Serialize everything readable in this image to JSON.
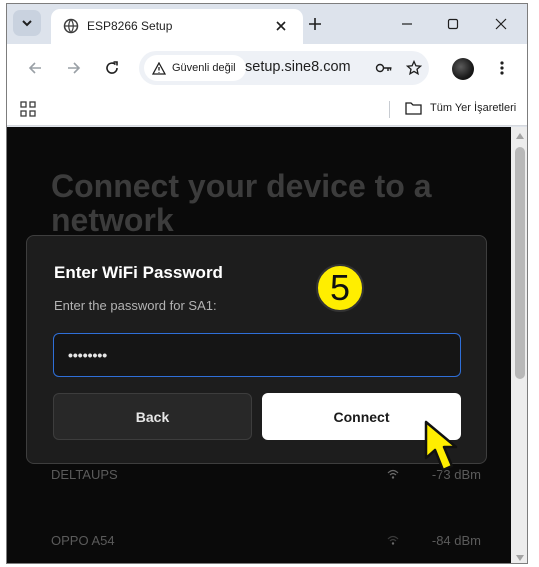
{
  "tab": {
    "title": "ESP8266 Setup"
  },
  "toolbar": {
    "security_label": "Güvenli değil",
    "url": "setup.sine8.com"
  },
  "bookmarks": {
    "folder_label": "Tüm Yer İşaretleri"
  },
  "page": {
    "heading": "Connect your device to a network",
    "networks": [
      {
        "name": "DELTAUPS",
        "signal": "-73 dBm"
      },
      {
        "name": "OPPO A54",
        "signal": "-84 dBm"
      }
    ]
  },
  "dialog": {
    "title": "Enter WiFi Password",
    "description": "Enter the password for SA1:",
    "password_value": "••••••••",
    "back_label": "Back",
    "connect_label": "Connect"
  },
  "annotation": {
    "step_number": "5",
    "badge_color": "#ffee00"
  },
  "colors": {
    "input_focus": "#2f6fd8",
    "page_bg": "#0a0a0a",
    "dialog_bg": "#1d1d1d"
  }
}
